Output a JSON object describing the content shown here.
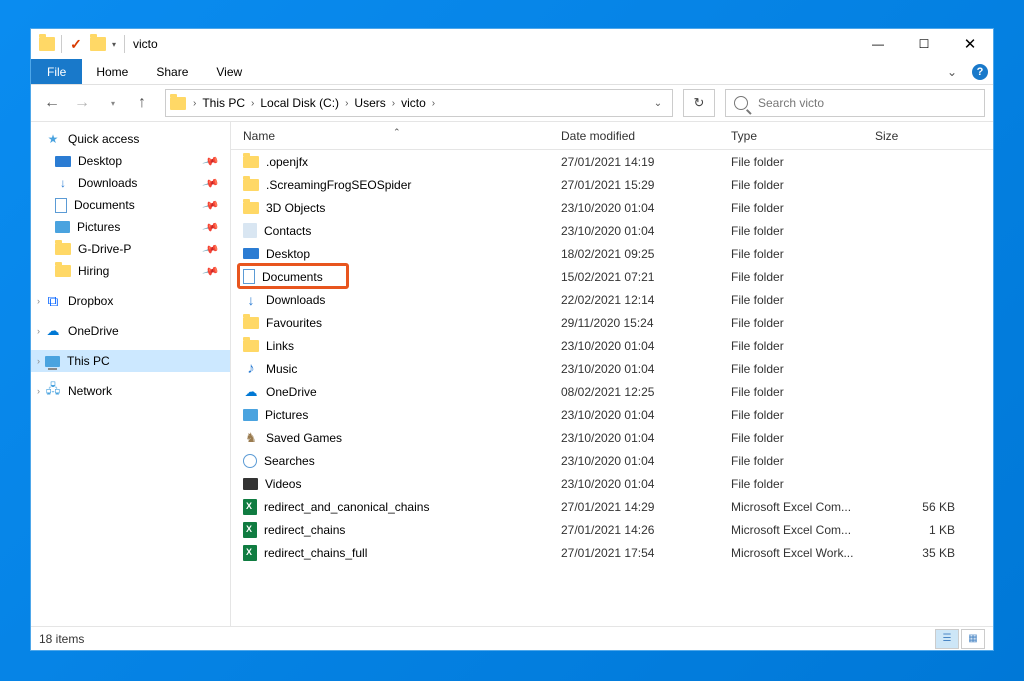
{
  "window": {
    "title": "victo"
  },
  "ribbon": {
    "file": "File",
    "tabs": [
      "Home",
      "Share",
      "View"
    ]
  },
  "breadcrumb": [
    "This PC",
    "Local Disk (C:)",
    "Users",
    "victo"
  ],
  "search": {
    "placeholder": "Search victo"
  },
  "columns": {
    "name": "Name",
    "date": "Date modified",
    "type": "Type",
    "size": "Size"
  },
  "sidebar": {
    "quick_access": "Quick access",
    "quick_items": [
      {
        "label": "Desktop",
        "icon": "desktop-i",
        "pinned": true
      },
      {
        "label": "Downloads",
        "icon": "downloads-i",
        "pinned": true
      },
      {
        "label": "Documents",
        "icon": "documents-i",
        "pinned": true
      },
      {
        "label": "Pictures",
        "icon": "pictures-i",
        "pinned": true
      },
      {
        "label": "G-Drive-P",
        "icon": "folder-i",
        "pinned": true
      },
      {
        "label": "Hiring",
        "icon": "folder-i",
        "pinned": true
      }
    ],
    "dropbox": "Dropbox",
    "onedrive": "OneDrive",
    "thispc": "This PC",
    "network": "Network"
  },
  "files": [
    {
      "name": ".openjfx",
      "date": "27/01/2021 14:19",
      "type": "File folder",
      "size": "",
      "icon": "folder"
    },
    {
      "name": ".ScreamingFrogSEOSpider",
      "date": "27/01/2021 15:29",
      "type": "File folder",
      "size": "",
      "icon": "folder"
    },
    {
      "name": "3D Objects",
      "date": "23/10/2020 01:04",
      "type": "File folder",
      "size": "",
      "icon": "folder"
    },
    {
      "name": "Contacts",
      "date": "23/10/2020 01:04",
      "type": "File folder",
      "size": "",
      "icon": "contacts"
    },
    {
      "name": "Desktop",
      "date": "18/02/2021 09:25",
      "type": "File folder",
      "size": "",
      "icon": "desktop"
    },
    {
      "name": "Documents",
      "date": "15/02/2021 07:21",
      "type": "File folder",
      "size": "",
      "icon": "docs",
      "highlight": true
    },
    {
      "name": "Downloads",
      "date": "22/02/2021 12:14",
      "type": "File folder",
      "size": "",
      "icon": "down"
    },
    {
      "name": "Favourites",
      "date": "29/11/2020 15:24",
      "type": "File folder",
      "size": "",
      "icon": "folder"
    },
    {
      "name": "Links",
      "date": "23/10/2020 01:04",
      "type": "File folder",
      "size": "",
      "icon": "links"
    },
    {
      "name": "Music",
      "date": "23/10/2020 01:04",
      "type": "File folder",
      "size": "",
      "icon": "music"
    },
    {
      "name": "OneDrive",
      "date": "08/02/2021 12:25",
      "type": "File folder",
      "size": "",
      "icon": "onedrive"
    },
    {
      "name": "Pictures",
      "date": "23/10/2020 01:04",
      "type": "File folder",
      "size": "",
      "icon": "pics"
    },
    {
      "name": "Saved Games",
      "date": "23/10/2020 01:04",
      "type": "File folder",
      "size": "",
      "icon": "saved"
    },
    {
      "name": "Searches",
      "date": "23/10/2020 01:04",
      "type": "File folder",
      "size": "",
      "icon": "search-i"
    },
    {
      "name": "Videos",
      "date": "23/10/2020 01:04",
      "type": "File folder",
      "size": "",
      "icon": "video"
    },
    {
      "name": "redirect_and_canonical_chains",
      "date": "27/01/2021 14:29",
      "type": "Microsoft Excel Com...",
      "size": "56 KB",
      "icon": "excel"
    },
    {
      "name": "redirect_chains",
      "date": "27/01/2021 14:26",
      "type": "Microsoft Excel Com...",
      "size": "1 KB",
      "icon": "excel"
    },
    {
      "name": "redirect_chains_full",
      "date": "27/01/2021 17:54",
      "type": "Microsoft Excel Work...",
      "size": "35 KB",
      "icon": "excel"
    }
  ],
  "status": {
    "count": "18 items"
  }
}
